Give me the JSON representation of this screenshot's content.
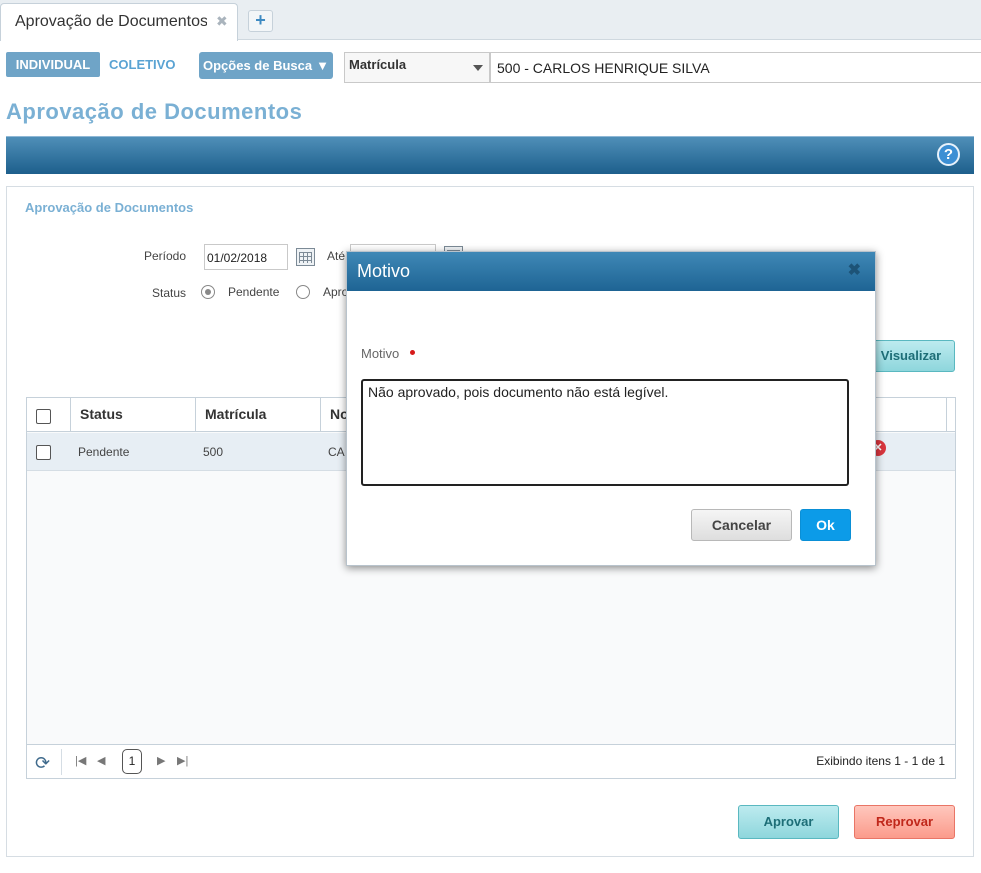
{
  "tabs": {
    "active_label": "Aprovação de Documentos",
    "close_glyph": "✖",
    "add_glyph": "+"
  },
  "toolbar": {
    "individual_label": "INDIVIDUAL",
    "coletivo_label": "COLETIVO",
    "opcoes_label": "Opções de Busca",
    "opcoes_caret": "▼",
    "search_type_value": "Matrícula",
    "employee_value": "500 - CARLOS HENRIQUE SILVA"
  },
  "page": {
    "title": "Aprovação de Documentos",
    "help_glyph": "?"
  },
  "panel": {
    "title": "Aprovação de Documentos",
    "periodo_label": "Período",
    "periodo_from": "01/02/2018",
    "ate_label": "Até",
    "status_label": "Status",
    "status_options": [
      "Pendente",
      "Apro"
    ],
    "status_selected": "Pendente",
    "visualizar_label": "Visualizar"
  },
  "grid": {
    "columns": [
      "Status",
      "Matrícula",
      "No"
    ],
    "rows": [
      {
        "status": "Pendente",
        "matricula": "500",
        "nome": "CA"
      }
    ],
    "current_page": "1",
    "info": "Exibindo itens 1 - 1 de 1"
  },
  "actions": {
    "aprovar_label": "Aprovar",
    "reprovar_label": "Reprovar"
  },
  "modal": {
    "title": "Motivo",
    "close_glyph": "✖",
    "field_label": "Motivo",
    "reason_value": "Não aprovado, pois documento não está legível.",
    "cancel_label": "Cancelar",
    "ok_label": "Ok"
  },
  "colors": {
    "accent_blue": "#7ab0d4",
    "band_dark": "#1d5f8c",
    "ok_button": "#0c9be8",
    "approve": "#8ed6dc",
    "reject": "#fb9b8b"
  },
  "icons": [
    "tab-close-icon",
    "add-tab-icon",
    "help-icon",
    "calendar-icon",
    "delete-icon",
    "refresh-icon",
    "first-page-icon",
    "prev-page-icon",
    "next-page-icon",
    "last-page-icon",
    "modal-close-icon"
  ]
}
